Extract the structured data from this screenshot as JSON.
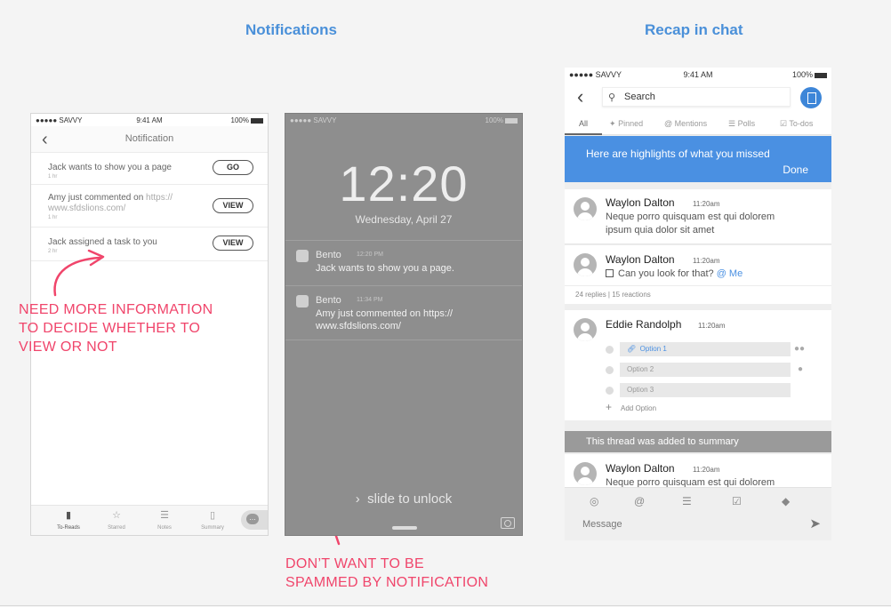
{
  "sections": {
    "notifications_title": "Notifications",
    "recap_title": "Recap in chat"
  },
  "phone1": {
    "status": {
      "carrier": "●●●●● SAVVY",
      "time": "9:41 AM",
      "battery": "100%"
    },
    "nav": {
      "back_icon": "chevron-left-icon",
      "title": "Notification"
    },
    "rows": [
      {
        "text": "Jack wants to show you a page",
        "sub": "1 hr",
        "button": "GO"
      },
      {
        "text": "Amy just commented on ",
        "link": "https://",
        "text2": "www.sfdslions.com/",
        "sub": "1 hr",
        "button": "VIEW"
      },
      {
        "text": "Jack assigned a task to you",
        "sub": "2 hr",
        "button": "VIEW"
      }
    ],
    "tabs": [
      {
        "icon": "bookmark-icon",
        "label": "To-Reads"
      },
      {
        "icon": "star-icon",
        "label": "Starred"
      },
      {
        "icon": "notes-icon",
        "label": "Notes"
      },
      {
        "icon": "document-icon",
        "label": "Summary"
      }
    ],
    "chat_icon": "chat-bubble-icon"
  },
  "annotations": {
    "left": [
      "NEED MORE INFORMATION",
      "TO DECIDE WHETHER TO",
      "VIEW OR NOT"
    ],
    "bottom": [
      "DON’T WANT TO BE",
      "SPAMMED BY NOTIFICATION"
    ],
    "color": "#f0456b"
  },
  "phone2": {
    "status": {
      "carrier": "●●●●● SAVVY",
      "battery": "100%"
    },
    "time": "12:20",
    "date": "Wednesday, April 27",
    "notifications": [
      {
        "app": "Bento",
        "time": "12:20 PM",
        "lines": [
          "Jack wants to show you a page."
        ]
      },
      {
        "app": "Bento",
        "time": "11:34 PM",
        "lines": [
          "Amy just commented on https://",
          "www.sfdslions.com/"
        ]
      }
    ],
    "slide": "slide to unlock",
    "camera_icon": "camera-icon"
  },
  "phone3": {
    "status": {
      "carrier": "●●●●● SAVVY",
      "time": "9:41 AM",
      "battery": "100%"
    },
    "search_placeholder": "Search",
    "tabs": [
      "All",
      "Pinned",
      "@ Mentions",
      "Polls",
      "To-dos"
    ],
    "highlight": {
      "text": "Here are highlights of what you missed",
      "action": "Done",
      "color": "#4a90e2"
    },
    "messages": [
      {
        "name": "Waylon Dalton",
        "time": "11:20am",
        "lines": [
          "Neque porro quisquam est qui dolorem",
          "ipsum quia dolor sit amet"
        ]
      },
      {
        "name": "Waylon Dalton",
        "time": "11:20am",
        "text": "Can you look for that?",
        "mention": "@ Me",
        "meta": "24 replies | 15 reactions"
      },
      {
        "name": "Eddie Randolph",
        "time": "11:20am",
        "options": [
          "Option 1",
          "Option 2",
          "Option 3"
        ],
        "add_option": "Add Option"
      }
    ],
    "thread_summary": "This thread was added to summary",
    "last_message": {
      "name": "Waylon Dalton",
      "time": "11:20am",
      "text": "Neque porro quisquam est qui dolorem"
    },
    "toolbar": [
      "eye-icon",
      "at-icon",
      "list-icon",
      "checkbox-icon",
      "tag-icon"
    ],
    "message_placeholder": "Message",
    "send_icon": "send-icon"
  }
}
